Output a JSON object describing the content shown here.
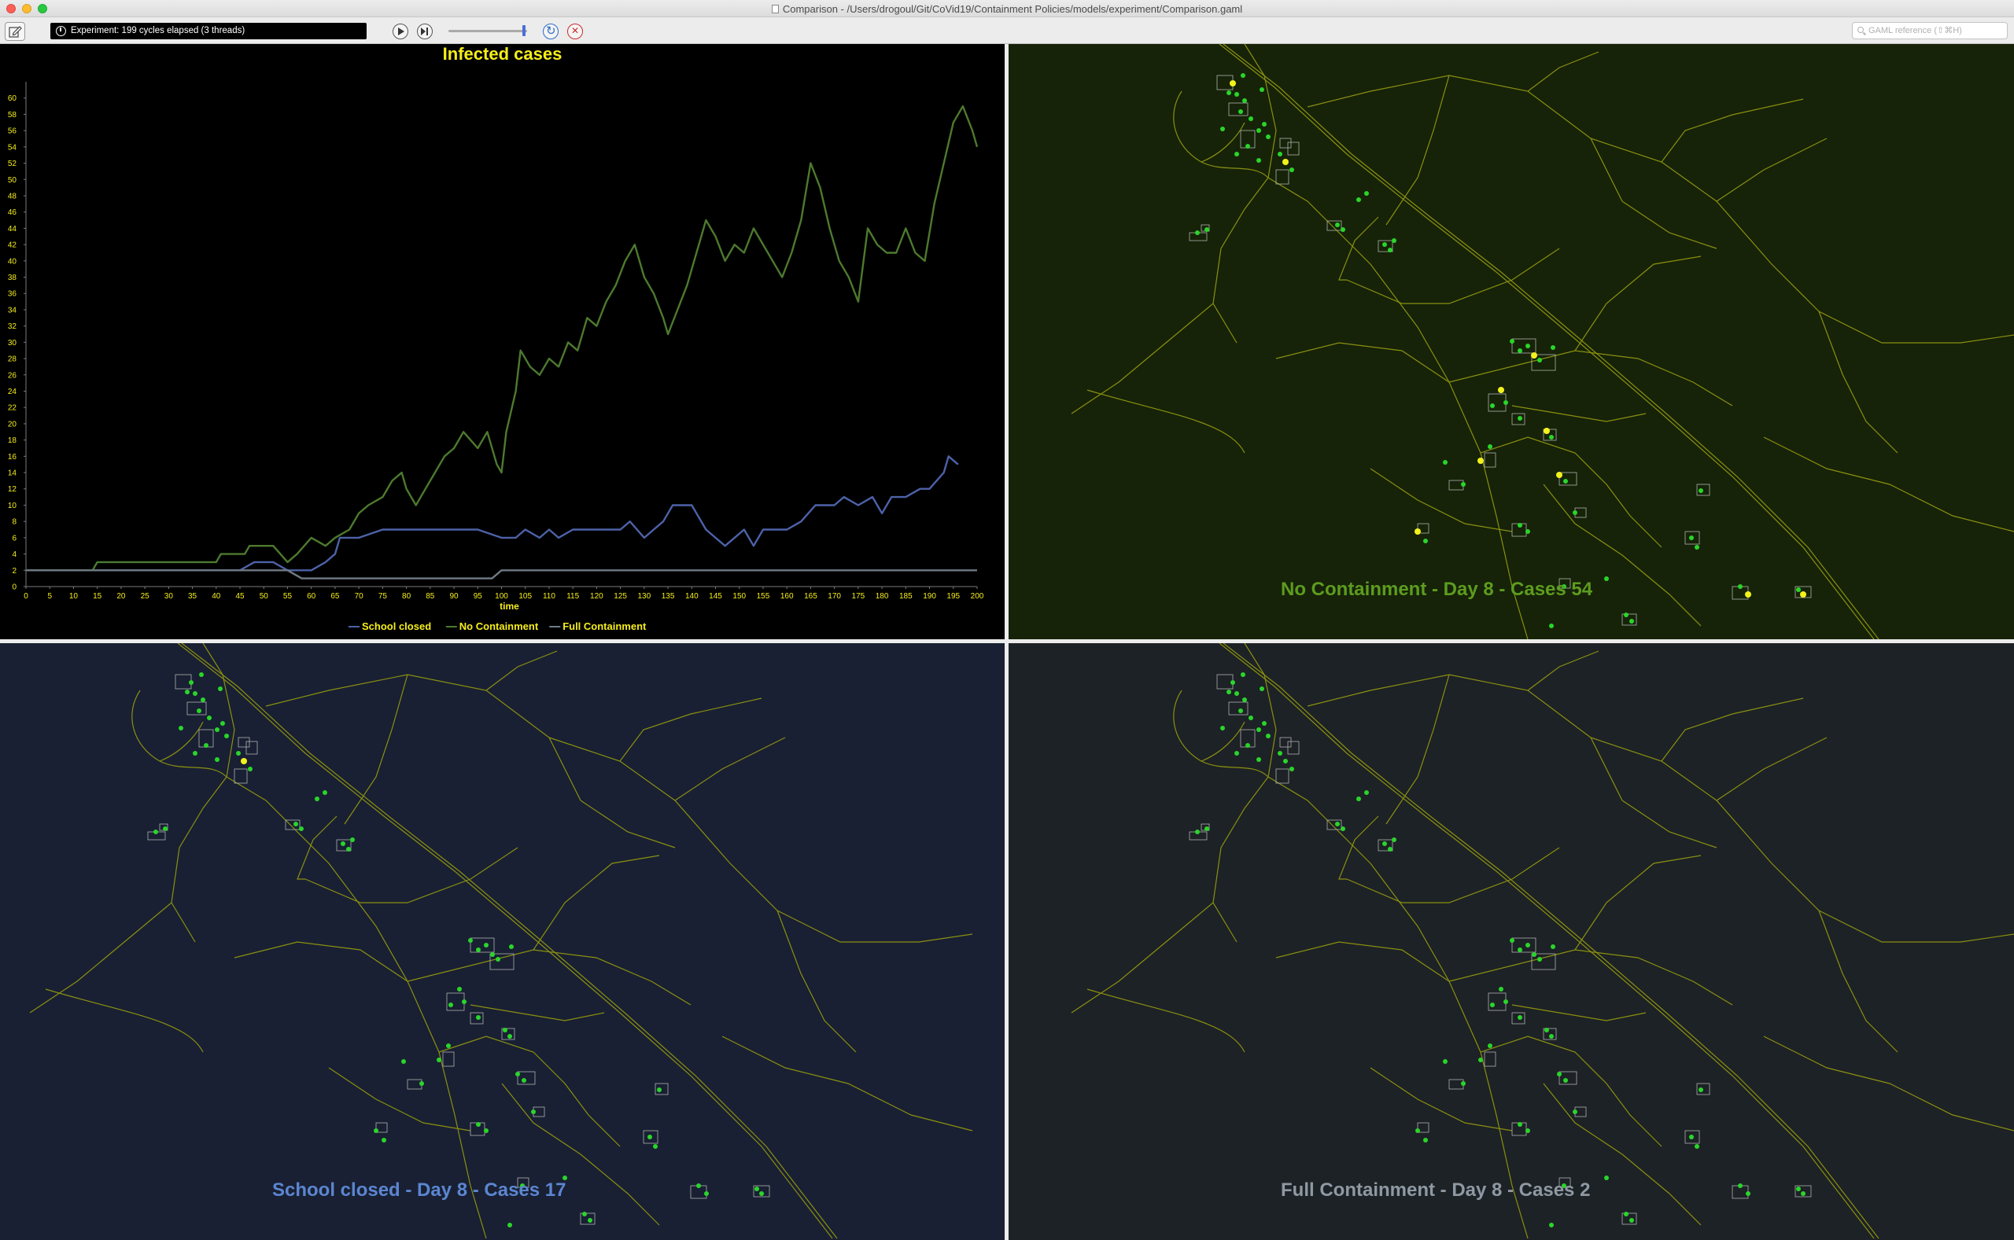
{
  "window": {
    "title": "Comparison - /Users/drogoul/Git/CoVid19/Containment Policies/models/experiment/Comparison.gaml"
  },
  "toolbar": {
    "status_text": "Experiment: 199 cycles elapsed (3 threads)",
    "search_placeholder": "GAML reference (⇧⌘H)",
    "icons": [
      "edit-icon",
      "clock-icon",
      "play-icon",
      "step-icon",
      "reload-icon",
      "close-icon",
      "search-icon"
    ]
  },
  "displays": {
    "no_containment": {
      "caption": "No Containment - Day 8 - Cases 54"
    },
    "school_closed": {
      "caption": "School closed - Day 8 - Cases 17"
    },
    "full_containment": {
      "caption": "Full Containment - Day 8 - Cases 2"
    }
  },
  "colors": {
    "chart_title": "#f5ee1a",
    "series_no_containment": "#4d7a2e",
    "series_school_closed": "#4d62a8",
    "series_full_containment": "#6f7a85",
    "axis_text": "#f5ee1a",
    "road": "#8a9010",
    "infected": "#f2f21c",
    "healthy": "#2ad52a"
  },
  "chart_data": {
    "type": "line",
    "title": "Infected cases",
    "xlabel": "time",
    "ylabel": "",
    "xlim": [
      0,
      200
    ],
    "ylim": [
      0,
      62
    ],
    "xticks": [
      0,
      5,
      10,
      15,
      20,
      25,
      30,
      35,
      40,
      45,
      50,
      55,
      60,
      65,
      70,
      75,
      80,
      85,
      90,
      95,
      100,
      105,
      110,
      115,
      120,
      125,
      130,
      135,
      140,
      145,
      150,
      155,
      160,
      165,
      170,
      175,
      180,
      185,
      190,
      195,
      200
    ],
    "yticks": [
      0,
      2,
      4,
      6,
      8,
      10,
      12,
      14,
      16,
      18,
      20,
      22,
      24,
      26,
      28,
      30,
      32,
      34,
      36,
      38,
      40,
      42,
      44,
      46,
      48,
      50,
      52,
      54,
      56,
      58,
      60
    ],
    "legend_position": "bottom",
    "series": [
      {
        "name": "School closed",
        "color": "#4d62a8",
        "points": [
          [
            0,
            2
          ],
          [
            15,
            2
          ],
          [
            30,
            2
          ],
          [
            45,
            2
          ],
          [
            48,
            3
          ],
          [
            52,
            3
          ],
          [
            55,
            2
          ],
          [
            60,
            2
          ],
          [
            63,
            3
          ],
          [
            65,
            4
          ],
          [
            66,
            6
          ],
          [
            70,
            6
          ],
          [
            75,
            7
          ],
          [
            85,
            7
          ],
          [
            95,
            7
          ],
          [
            100,
            6
          ],
          [
            103,
            6
          ],
          [
            105,
            7
          ],
          [
            108,
            6
          ],
          [
            110,
            7
          ],
          [
            112,
            6
          ],
          [
            115,
            7
          ],
          [
            120,
            7
          ],
          [
            125,
            7
          ],
          [
            127,
            8
          ],
          [
            130,
            6
          ],
          [
            132,
            7
          ],
          [
            134,
            8
          ],
          [
            136,
            10
          ],
          [
            140,
            10
          ],
          [
            143,
            7
          ],
          [
            145,
            6
          ],
          [
            147,
            5
          ],
          [
            149,
            6
          ],
          [
            151,
            7
          ],
          [
            153,
            5
          ],
          [
            155,
            7
          ],
          [
            160,
            7
          ],
          [
            163,
            8
          ],
          [
            166,
            10
          ],
          [
            170,
            10
          ],
          [
            172,
            11
          ],
          [
            175,
            10
          ],
          [
            178,
            11
          ],
          [
            180,
            9
          ],
          [
            182,
            11
          ],
          [
            185,
            11
          ],
          [
            188,
            12
          ],
          [
            190,
            12
          ],
          [
            193,
            14
          ],
          [
            194,
            16
          ],
          [
            196,
            15
          ]
        ]
      },
      {
        "name": "No Containment",
        "color": "#4d7a2e",
        "points": [
          [
            0,
            2
          ],
          [
            14,
            2
          ],
          [
            15,
            3
          ],
          [
            20,
            3
          ],
          [
            30,
            3
          ],
          [
            40,
            3
          ],
          [
            41,
            4
          ],
          [
            46,
            4
          ],
          [
            47,
            5
          ],
          [
            52,
            5
          ],
          [
            55,
            3
          ],
          [
            57,
            4
          ],
          [
            60,
            6
          ],
          [
            63,
            5
          ],
          [
            65,
            6
          ],
          [
            68,
            7
          ],
          [
            70,
            9
          ],
          [
            72,
            10
          ],
          [
            75,
            11
          ],
          [
            77,
            13
          ],
          [
            79,
            14
          ],
          [
            80,
            12
          ],
          [
            82,
            10
          ],
          [
            84,
            12
          ],
          [
            86,
            14
          ],
          [
            88,
            16
          ],
          [
            90,
            17
          ],
          [
            92,
            19
          ],
          [
            95,
            17
          ],
          [
            97,
            19
          ],
          [
            99,
            15
          ],
          [
            100,
            14
          ],
          [
            101,
            19
          ],
          [
            103,
            24
          ],
          [
            104,
            29
          ],
          [
            106,
            27
          ],
          [
            108,
            26
          ],
          [
            110,
            28
          ],
          [
            112,
            27
          ],
          [
            114,
            30
          ],
          [
            116,
            29
          ],
          [
            118,
            33
          ],
          [
            120,
            32
          ],
          [
            122,
            35
          ],
          [
            124,
            37
          ],
          [
            126,
            40
          ],
          [
            128,
            42
          ],
          [
            130,
            38
          ],
          [
            132,
            36
          ],
          [
            134,
            33
          ],
          [
            135,
            31
          ],
          [
            137,
            34
          ],
          [
            139,
            37
          ],
          [
            141,
            41
          ],
          [
            143,
            45
          ],
          [
            145,
            43
          ],
          [
            147,
            40
          ],
          [
            149,
            42
          ],
          [
            151,
            41
          ],
          [
            153,
            44
          ],
          [
            155,
            42
          ],
          [
            157,
            40
          ],
          [
            159,
            38
          ],
          [
            161,
            41
          ],
          [
            163,
            45
          ],
          [
            165,
            52
          ],
          [
            167,
            49
          ],
          [
            169,
            44
          ],
          [
            171,
            40
          ],
          [
            173,
            38
          ],
          [
            175,
            35
          ],
          [
            177,
            44
          ],
          [
            179,
            42
          ],
          [
            181,
            41
          ],
          [
            183,
            41
          ],
          [
            185,
            44
          ],
          [
            187,
            41
          ],
          [
            189,
            40
          ],
          [
            191,
            47
          ],
          [
            193,
            52
          ],
          [
            195,
            57
          ],
          [
            197,
            59
          ],
          [
            199,
            56
          ],
          [
            200,
            54
          ]
        ]
      },
      {
        "name": "Full Containment",
        "color": "#6f7a85",
        "points": [
          [
            0,
            2
          ],
          [
            55,
            2
          ],
          [
            58,
            1
          ],
          [
            98,
            1
          ],
          [
            100,
            2
          ],
          [
            200,
            2
          ]
        ]
      }
    ]
  }
}
